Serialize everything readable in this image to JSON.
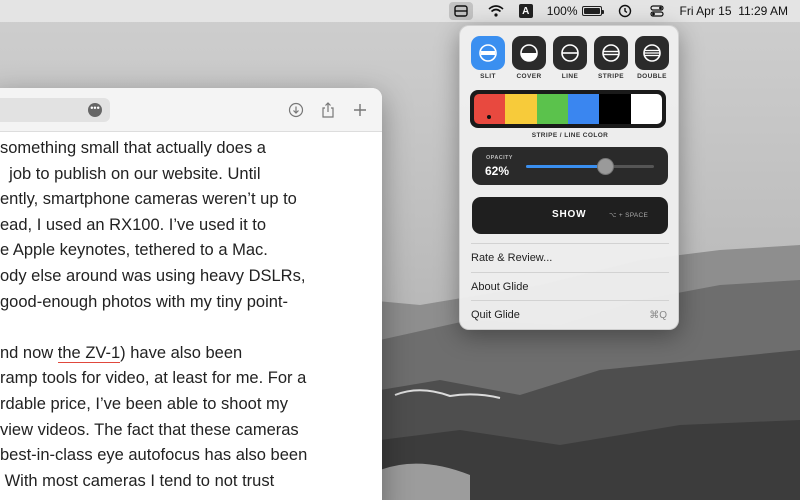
{
  "menubar": {
    "icons": [
      "glide-icon",
      "wifi-icon",
      "keyboard-input-icon",
      "battery-icon",
      "time-machine-icon",
      "control-center-icon"
    ],
    "input_letter": "A",
    "battery": "100%",
    "battery_level": 1.0,
    "datetime": "Fri Apr 15  11:29 AM"
  },
  "browser": {
    "url_more": "•••",
    "article": {
      "para1": [
        "something small that actually does a",
        "  job to publish on our website. Until",
        "ently, smartphone cameras weren’t up to",
        "ead, I used an RX100. I’ve used it to",
        "e Apple keynotes, tethered to a Mac.",
        "ody else around was using heavy DSLRs,",
        "good-enough photos with my tiny point-"
      ],
      "para2_line1_before": "nd now ",
      "para2_link": "the ZV-1",
      "para2_line1_after": ") have also been",
      "para2": [
        "ramp tools for video, at least for me. For a",
        "rdable price, I’ve been able to shoot my",
        "view videos. The fact that these cameras",
        "best-in-class eye autofocus has also been",
        " With most cameras I tend to not trust"
      ]
    }
  },
  "glide": {
    "modes": [
      {
        "label": "SLIT",
        "icon": "slit-icon",
        "selected": true
      },
      {
        "label": "COVER",
        "icon": "cover-icon",
        "selected": false
      },
      {
        "label": "LINE",
        "icon": "line-icon",
        "selected": false
      },
      {
        "label": "STRIPE",
        "icon": "stripe-icon",
        "selected": false
      },
      {
        "label": "DOUBLE",
        "icon": "double-icon",
        "selected": false
      }
    ],
    "colors": [
      "#e8493f",
      "#f7cb3a",
      "#5bc24c",
      "#3a86f0",
      "#000000",
      "#ffffff"
    ],
    "selected_color_index": 0,
    "color_label": "STRIPE / LINE COLOR",
    "opacity_caption": "OPACITY",
    "opacity_value": "62%",
    "opacity_level": 0.62,
    "show_label": "SHOW",
    "show_shortcut": "⌥ + SPACE",
    "menu": {
      "rate": "Rate & Review...",
      "about": "About Glide",
      "quit": "Quit Glide",
      "quit_shortcut": "⌘Q"
    }
  }
}
